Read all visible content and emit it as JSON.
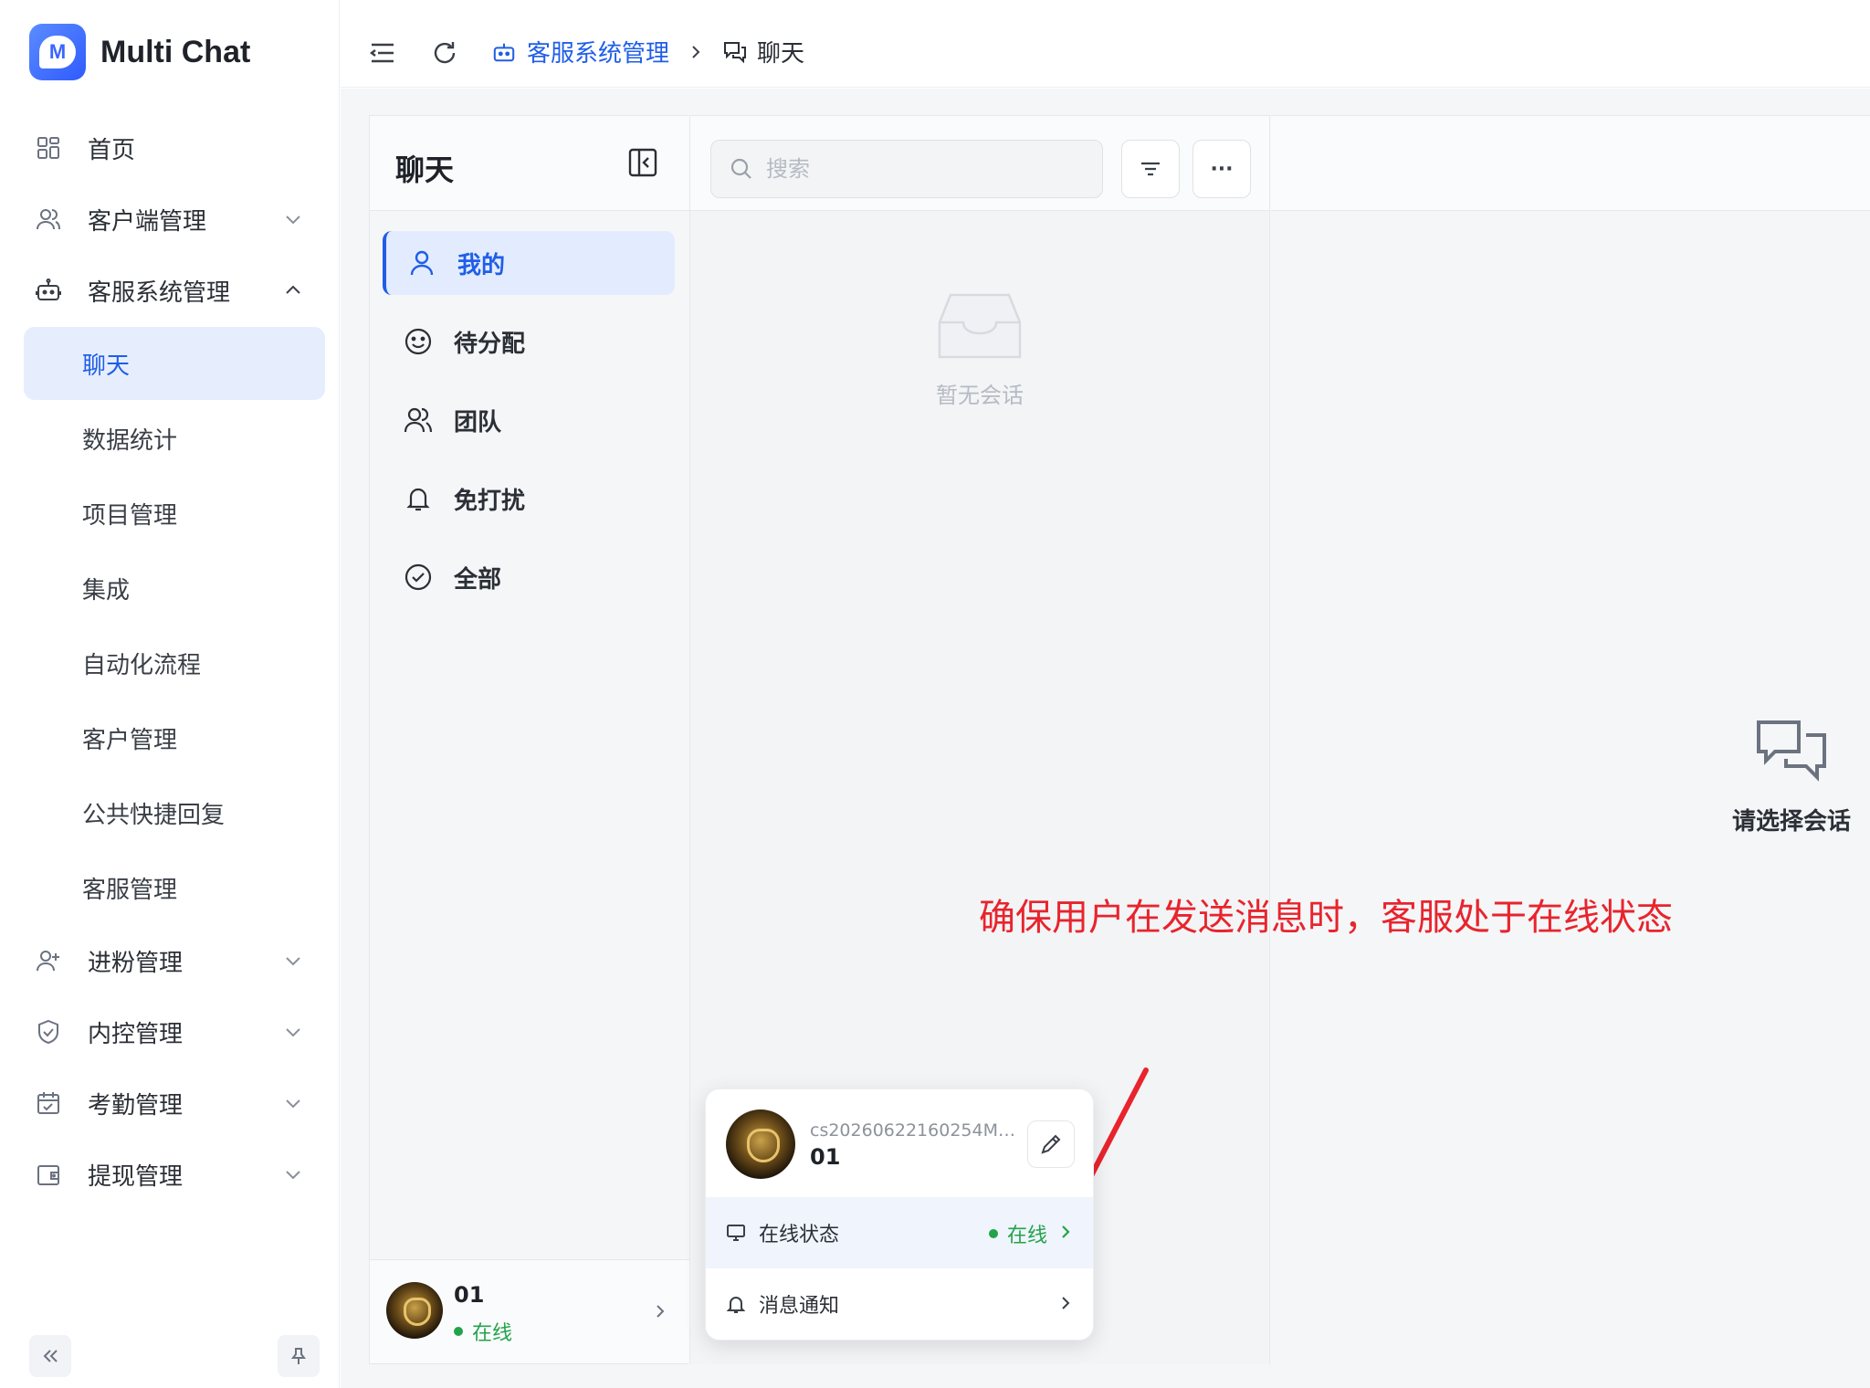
{
  "app": {
    "name": "Multi Chat",
    "logo_letter": "M"
  },
  "sidebar": {
    "items": [
      {
        "label": "首页",
        "icon": "grid-icon"
      },
      {
        "label": "客户端管理",
        "icon": "users-icon"
      },
      {
        "label": "客服系统管理",
        "icon": "robot-icon"
      }
    ],
    "submenu": [
      {
        "label": "聊天"
      },
      {
        "label": "数据统计"
      },
      {
        "label": "项目管理"
      },
      {
        "label": "集成"
      },
      {
        "label": "自动化流程"
      },
      {
        "label": "客户管理"
      },
      {
        "label": "公共快捷回复"
      },
      {
        "label": "客服管理"
      }
    ],
    "items_after": [
      {
        "label": "进粉管理",
        "icon": "user-add-icon"
      },
      {
        "label": "内控管理",
        "icon": "shield-icon"
      },
      {
        "label": "考勤管理",
        "icon": "calendar-icon"
      },
      {
        "label": "提现管理",
        "icon": "wallet-icon"
      }
    ]
  },
  "breadcrumb": {
    "parent": "客服系统管理",
    "current": "聊天"
  },
  "chat_nav": {
    "title": "聊天",
    "categories": [
      {
        "label": "我的",
        "icon": "user-icon"
      },
      {
        "label": "待分配",
        "icon": "smile-icon"
      },
      {
        "label": "团队",
        "icon": "team-icon"
      },
      {
        "label": "免打扰",
        "icon": "bell-icon"
      },
      {
        "label": "全部",
        "icon": "check-circle-icon"
      }
    ],
    "agent": {
      "name": "01",
      "status": "在线"
    }
  },
  "list": {
    "search_placeholder": "搜索",
    "more_label": "···",
    "empty_text": "暂无会话"
  },
  "main": {
    "hint": "请选择会话"
  },
  "annotation": {
    "text": "确保用户在发送消息时，客服处于在线状态",
    "color": "#e8242d"
  },
  "popover": {
    "account": "cs20260622160254M1...",
    "name": "01",
    "online_label": "在线状态",
    "online_value": "在线",
    "notify_label": "消息通知"
  },
  "colors": {
    "accent": "#1f5ee8",
    "online": "#22a34a"
  }
}
